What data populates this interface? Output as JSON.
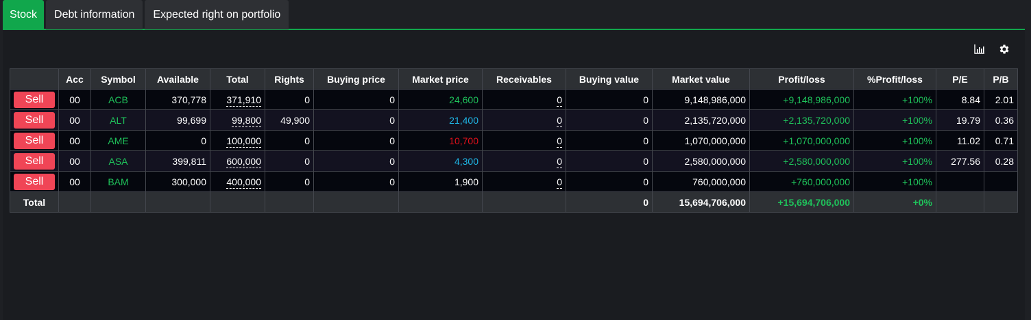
{
  "tabs": [
    {
      "label": "Stock",
      "active": true
    },
    {
      "label": "Debt information",
      "active": false
    },
    {
      "label": "Expected right on portfolio",
      "active": false
    }
  ],
  "toolbar": {
    "chart_icon": "bar-chart-icon",
    "settings_icon": "gear-icon"
  },
  "colors": {
    "accent": "#11a74c",
    "sell": "#f04556",
    "up": "#1fc35b",
    "ceiling": "#1fb8e8",
    "down": "#e3101a",
    "reference": "#ffffff"
  },
  "table": {
    "headers": [
      "",
      "Acc",
      "Symbol",
      "Available",
      "Total",
      "Rights",
      "Buying price",
      "Market price",
      "Receivables",
      "Buying value",
      "Market value",
      "Profit/loss",
      "%Profit/loss",
      "P/E",
      "P/B"
    ],
    "sell_label": "Sell",
    "rows": [
      {
        "acc": "00",
        "symbol": "ACB",
        "available": "370,778",
        "total": "371,910",
        "rights": "0",
        "buying_price": "0",
        "market_price": "24,600",
        "price_color": "green",
        "receivables": "0",
        "buying_value": "0",
        "market_value": "9,148,986,000",
        "profit_loss": "+9,148,986,000",
        "pct_profit_loss": "+100%",
        "pe": "8.84",
        "pb": "2.01"
      },
      {
        "acc": "00",
        "symbol": "ALT",
        "available": "99,699",
        "total": "99,800",
        "rights": "49,900",
        "buying_price": "0",
        "market_price": "21,400",
        "price_color": "cyan",
        "receivables": "0",
        "buying_value": "0",
        "market_value": "2,135,720,000",
        "profit_loss": "+2,135,720,000",
        "pct_profit_loss": "+100%",
        "pe": "19.79",
        "pb": "0.36"
      },
      {
        "acc": "00",
        "symbol": "AME",
        "available": "0",
        "total": "100,000",
        "rights": "0",
        "buying_price": "0",
        "market_price": "10,700",
        "price_color": "red",
        "receivables": "0",
        "buying_value": "0",
        "market_value": "1,070,000,000",
        "profit_loss": "+1,070,000,000",
        "pct_profit_loss": "+100%",
        "pe": "11.02",
        "pb": "0.71"
      },
      {
        "acc": "00",
        "symbol": "ASA",
        "available": "399,811",
        "total": "600,000",
        "rights": "0",
        "buying_price": "0",
        "market_price": "4,300",
        "price_color": "cyan",
        "receivables": "0",
        "buying_value": "0",
        "market_value": "2,580,000,000",
        "profit_loss": "+2,580,000,000",
        "pct_profit_loss": "+100%",
        "pe": "277.56",
        "pb": "0.28"
      },
      {
        "acc": "00",
        "symbol": "BAM",
        "available": "300,000",
        "total": "400,000",
        "rights": "0",
        "buying_price": "0",
        "market_price": "1,900",
        "price_color": "white",
        "receivables": "0",
        "buying_value": "0",
        "market_value": "760,000,000",
        "profit_loss": "+760,000,000",
        "pct_profit_loss": "+100%",
        "pe": "",
        "pb": ""
      }
    ],
    "footer": {
      "label": "Total",
      "buying_value": "0",
      "market_value": "15,694,706,000",
      "profit_loss": "+15,694,706,000",
      "pct_profit_loss": "+0%"
    }
  }
}
